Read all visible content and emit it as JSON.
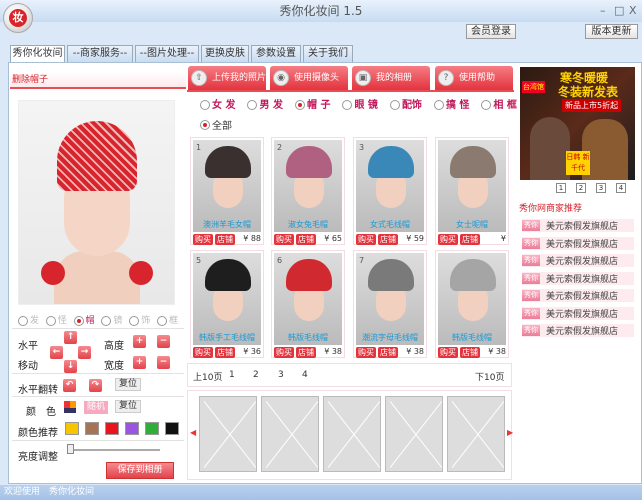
{
  "window": {
    "title": "秀你化妆间 1.5",
    "logo_char": "妆",
    "min": "–",
    "max": "□",
    "close": "X"
  },
  "top_buttons": {
    "login": "会员登录",
    "update": "版本更新"
  },
  "tabs": [
    "秀你化妆间",
    "--商家服务--",
    "--图片处理--",
    "更换皮肤",
    "参数设置",
    "关于我们"
  ],
  "left": {
    "header": "删除帽子",
    "radios": [
      {
        "label": "发",
        "on": false
      },
      {
        "label": "怪",
        "on": false
      },
      {
        "label": "帽",
        "on": true
      },
      {
        "label": "镜",
        "on": false
      },
      {
        "label": "饰",
        "on": false
      },
      {
        "label": "框",
        "on": false
      }
    ],
    "move_label_1": "水平",
    "move_label_2": "移动",
    "height_label": "高度",
    "width_label": "宽度",
    "flip_label": "水平翻转",
    "reset_label": "复位",
    "color_label": "颜　色",
    "random_label": "随机",
    "color_reset_label": "复位",
    "recommend_label": "颜色推荐",
    "swatches": [
      "#f7c400",
      "#a47454",
      "#e8161c",
      "#9b55e0",
      "#2fae3a",
      "#111111"
    ],
    "brightness_label": "亮度调整",
    "brightness_value": 0,
    "save_label": "保存到相册"
  },
  "action_buttons": [
    {
      "label": "上传我的照片",
      "icon": "upload-photo-icon"
    },
    {
      "label": "使用摄像头",
      "icon": "camera-icon"
    },
    {
      "label": "我的相册",
      "icon": "album-icon"
    },
    {
      "label": "使用帮助",
      "icon": "help-icon"
    }
  ],
  "categories": [
    {
      "label": "女 发",
      "on": false
    },
    {
      "label": "男 发",
      "on": false
    },
    {
      "label": "帽 子",
      "on": true
    },
    {
      "label": "眼 镜",
      "on": false
    },
    {
      "label": "配饰",
      "on": false
    },
    {
      "label": "搞 怪",
      "on": false
    },
    {
      "label": "相 框",
      "on": false
    }
  ],
  "all_label": "全部",
  "products": [
    {
      "num": "1",
      "name": "澳洲羊毛女帽",
      "price": "¥ 88",
      "color": "#3a3030"
    },
    {
      "num": "2",
      "name": "淑女兔毛帽",
      "price": "¥ 65",
      "color": "#b06080"
    },
    {
      "num": "3",
      "name": "女式毛线帽",
      "price": "¥ 59",
      "color": "#3a88b8"
    },
    {
      "num": "",
      "name": "女士呢帽",
      "price": "¥",
      "color": "#8a7a70"
    },
    {
      "num": "5",
      "name": "韩版手工毛线帽",
      "price": "¥ 36",
      "color": "#1e1e1e"
    },
    {
      "num": "6",
      "name": "韩版毛线帽",
      "price": "¥ 38",
      "color": "#d02a30"
    },
    {
      "num": "7",
      "name": "潮流字母毛线帽",
      "price": "¥ 38",
      "color": "#7a7a7a"
    },
    {
      "num": "",
      "name": "韩版毛线帽",
      "price": "¥ 38",
      "color": "#a5a5a5"
    }
  ],
  "buy_label": "购买",
  "shop_label": "店铺",
  "pagination": {
    "prev": "上10页",
    "pages": [
      "1",
      "2",
      "3",
      "4"
    ],
    "next": "下10页"
  },
  "ad": {
    "line1": "寒冬暖暖",
    "line2": "冬装新发表",
    "line3": "新品上市5折起",
    "badge": "台湾馆",
    "tag": "日韩 新千代",
    "pages": [
      "1",
      "2",
      "3",
      "4"
    ]
  },
  "recommend": {
    "title": "秀你网商家推荐",
    "tag": "秀你",
    "items": [
      "美元索假发旗舰店",
      "美元索假发旗舰店",
      "美元索假发旗舰店",
      "美元索假发旗舰店",
      "美元索假发旗舰店",
      "美元索假发旗舰店",
      "美元索假发旗舰店"
    ]
  },
  "status": "欢迎使用　秀你化妆间"
}
